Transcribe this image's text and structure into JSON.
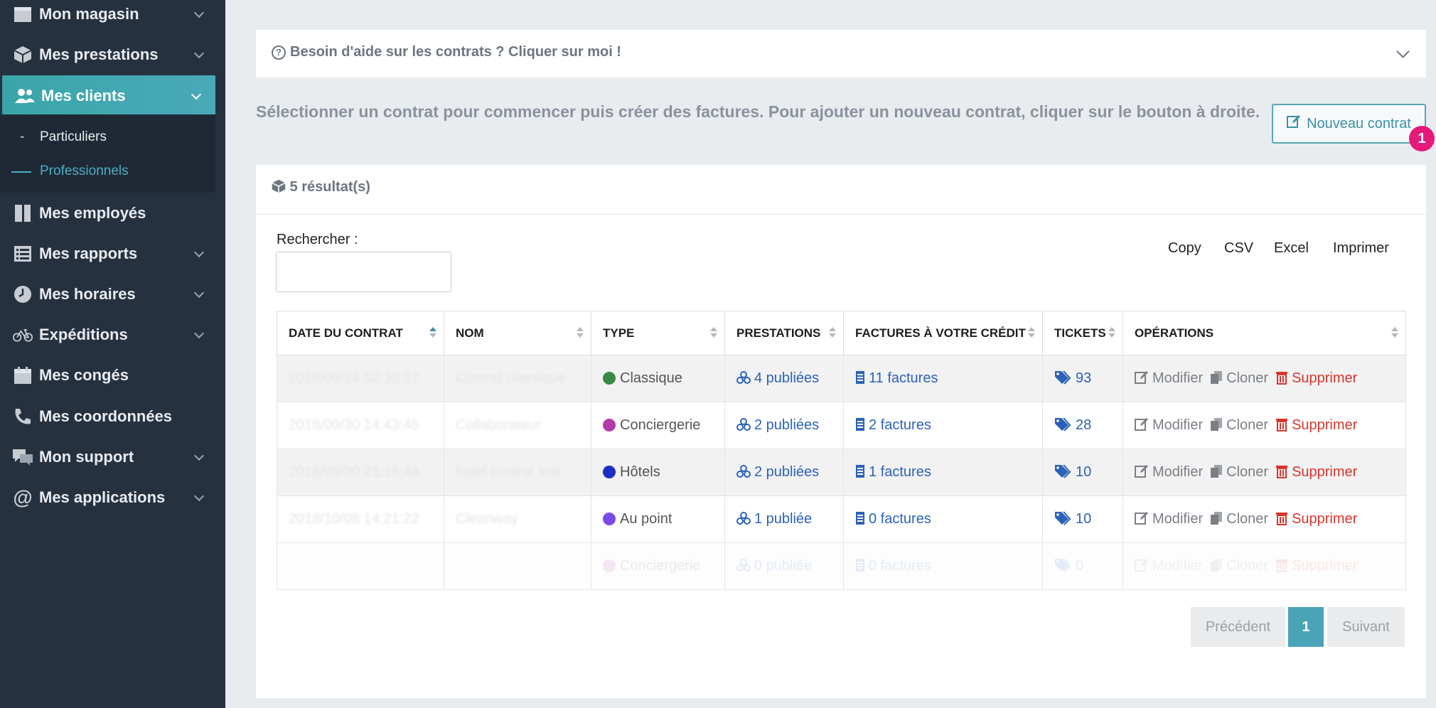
{
  "sidebar": {
    "items": [
      {
        "label": "Mon magasin",
        "icon": "store-icon"
      },
      {
        "label": "Mes prestations",
        "icon": "box-icon"
      },
      {
        "label": "Mes clients",
        "icon": "users-icon"
      },
      {
        "label": "Mes employés",
        "icon": "book-icon"
      },
      {
        "label": "Mes rapports",
        "icon": "list-icon"
      },
      {
        "label": "Mes horaires",
        "icon": "clock-icon"
      },
      {
        "label": "Expéditions",
        "icon": "bicycle-icon"
      },
      {
        "label": "Mes congés",
        "icon": "calendar-icon"
      },
      {
        "label": "Mes coordonnées",
        "icon": "phone-icon"
      },
      {
        "label": "Mon support",
        "icon": "comments-icon"
      },
      {
        "label": "Mes applications",
        "icon": "at-icon"
      }
    ],
    "submenu": [
      {
        "label": "Particuliers"
      },
      {
        "label": "Professionnels"
      }
    ],
    "colors": {
      "active": "#3fa8ae",
      "submenu_active": "#4aaec5"
    }
  },
  "help": {
    "text": "Besoin d'aide sur les contrats ? Cliquer sur moi !"
  },
  "intro": "Sélectionner un contrat pour commencer puis créer des factures. Pour ajouter un nouveau contrat, cliquer sur le bouton à droite.",
  "new_contract": {
    "label": "Nouveau contrat",
    "badge": "1"
  },
  "results": {
    "count_label": "5 résultat(s)"
  },
  "search": {
    "label": "Rechercher :",
    "value": ""
  },
  "exports": [
    "Copy",
    "CSV",
    "Excel",
    "Imprimer"
  ],
  "table": {
    "headers": [
      "DATE DU CONTRAT",
      "NOM",
      "TYPE",
      "PRESTATIONS",
      "FACTURES À VOTRE CRÉDIT",
      "TICKETS",
      "OPÉRATIONS"
    ],
    "rows": [
      {
        "date": "2018/09/24 02:30:27",
        "nom": "Contrat classique",
        "type": "Classique",
        "type_color": "#3a8a45",
        "prestations": "4 publiées",
        "factures": "11 factures",
        "tickets": "93"
      },
      {
        "date": "2018/09/30 14:43:45",
        "nom": "Collaborateur",
        "type": "Conciergerie",
        "type_color": "#b43aa9",
        "prestations": "2 publiées",
        "factures": "2 factures",
        "tickets": "28"
      },
      {
        "date": "2018/09/30 21:16:48",
        "nom": "hotel contrat test",
        "type": "Hôtels",
        "type_color": "#1a2fc8",
        "prestations": "2 publiées",
        "factures": "1 factures",
        "tickets": "10"
      },
      {
        "date": "2018/10/08 14:21:22",
        "nom": "Cleanway",
        "type": "Au point",
        "type_color": "#7a4ae8",
        "prestations": "1 publiée",
        "factures": "0 factures",
        "tickets": "10"
      },
      {
        "date": "",
        "nom": "",
        "type": "Conciergerie",
        "type_color": "#b43aa9",
        "prestations": "0 publiée",
        "factures": "0 factures",
        "tickets": "0"
      }
    ],
    "ops": {
      "modify": "Modifier",
      "clone": "Cloner",
      "delete": "Supprimer"
    }
  },
  "pagination": {
    "prev": "Précédent",
    "current": "1",
    "next": "Suivant"
  }
}
